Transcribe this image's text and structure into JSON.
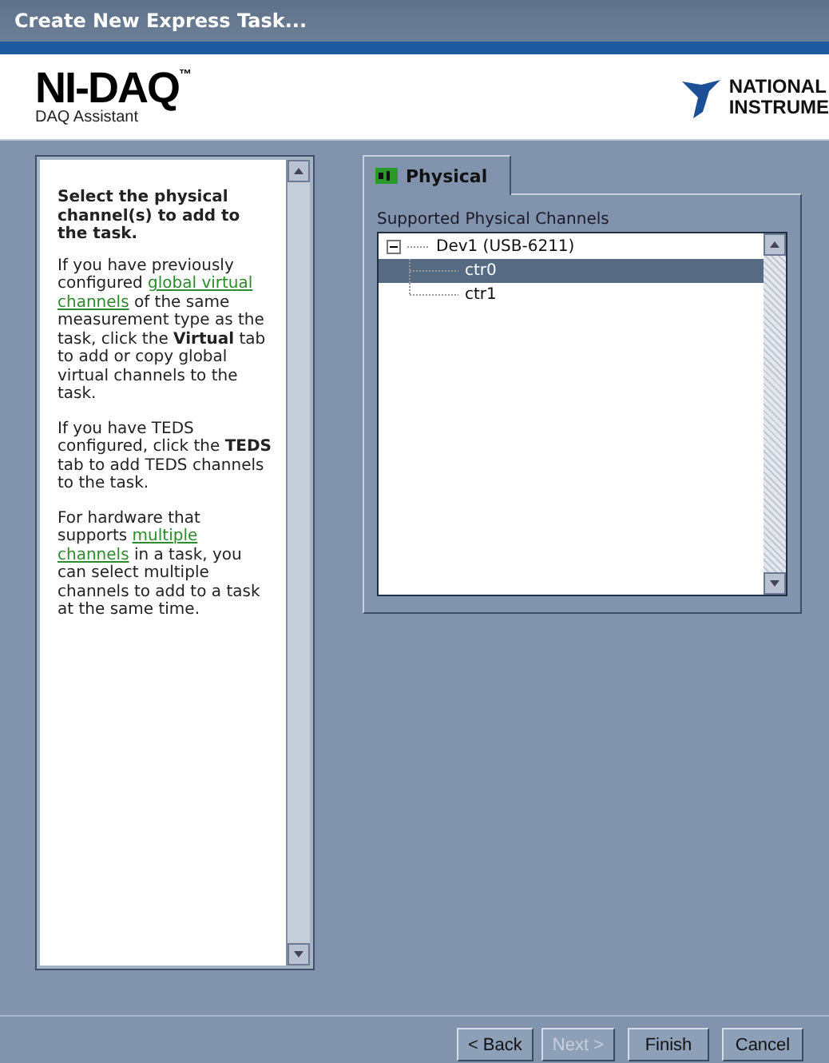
{
  "window": {
    "title": "Create New Express Task..."
  },
  "header": {
    "product": "NI-DAQ",
    "trademark": "™",
    "subtitle": "DAQ Assistant",
    "logo_lines": [
      "NATIONAL",
      "INSTRUME"
    ]
  },
  "help": {
    "heading": "Select the physical channel(s) to add to the task.",
    "paragraphs": [
      [
        {
          "kind": "text",
          "text": "If you have previously configured "
        },
        {
          "kind": "link",
          "text": "global virtual"
        },
        {
          "kind": "link",
          "text": "channels"
        },
        {
          "kind": "text",
          "text": " of the same measurement type as the task, click the **Virtual** tab to add or copy global virtual channels to the task."
        }
      ],
      [
        {
          "kind": "text",
          "text": "If you have TEDS configured, click the **TEDS** tab to add TEDS channels to the task."
        }
      ],
      [
        {
          "kind": "text",
          "text": "For hardware that supports "
        },
        {
          "kind": "link",
          "text": "multiple"
        },
        {
          "kind": "link",
          "text": "channels"
        },
        {
          "kind": "text",
          "text": " in a task, you can select multiple channels to add to a task at the same time."
        }
      ]
    ]
  },
  "tabs": [
    {
      "label": "Physical",
      "selected": true
    }
  ],
  "channels": {
    "label": "Supported Physical Channels",
    "tree": [
      {
        "label": "Dev1  (USB-6211)",
        "expanded": true,
        "selected": false,
        "children": [
          {
            "label": "ctr0",
            "selected": true
          },
          {
            "label": "ctr1",
            "selected": false
          }
        ]
      }
    ]
  },
  "buttons": [
    {
      "label": "< Back",
      "disabled": false
    },
    {
      "label": "Next >",
      "disabled": true
    },
    {
      "label": "Finish",
      "disabled": false
    },
    {
      "label": "Cancel",
      "disabled": false
    }
  ]
}
